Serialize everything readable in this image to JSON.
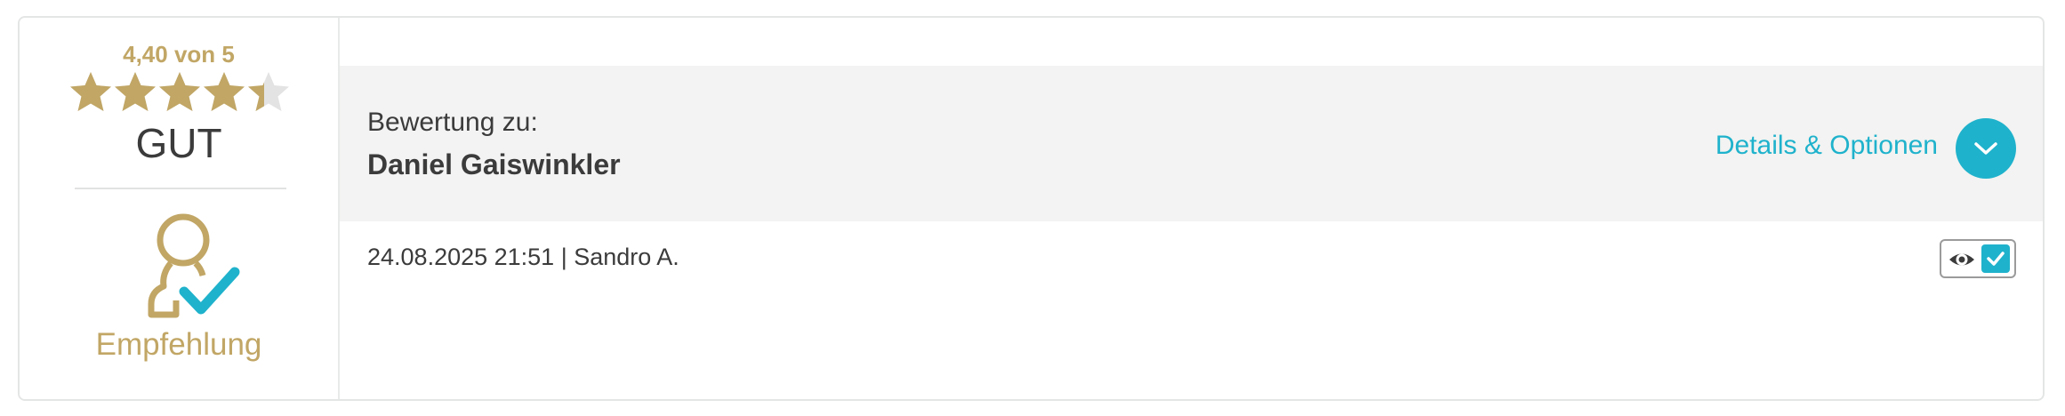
{
  "rating": {
    "score_text": "4,40 von 5",
    "score": 4.4,
    "max": 5,
    "grade": "GUT",
    "recommendation": "Empfehlung",
    "colors": {
      "gold": "#c1a665",
      "star_empty": "#e3e3e3",
      "accent": "#1fb2cc"
    }
  },
  "review": {
    "subject_label": "Bewertung zu:",
    "subject_name": "Daniel Gaiswinkler",
    "details_label": "Details & Optionen",
    "meta": "24.08.2025 21:51 | Sandro A."
  },
  "icons": {
    "stars": "star-icon",
    "recommendation": "person-check-icon",
    "details_toggle": "chevron-down-icon",
    "visibility": "eye-icon",
    "status": "checkmark-icon"
  }
}
